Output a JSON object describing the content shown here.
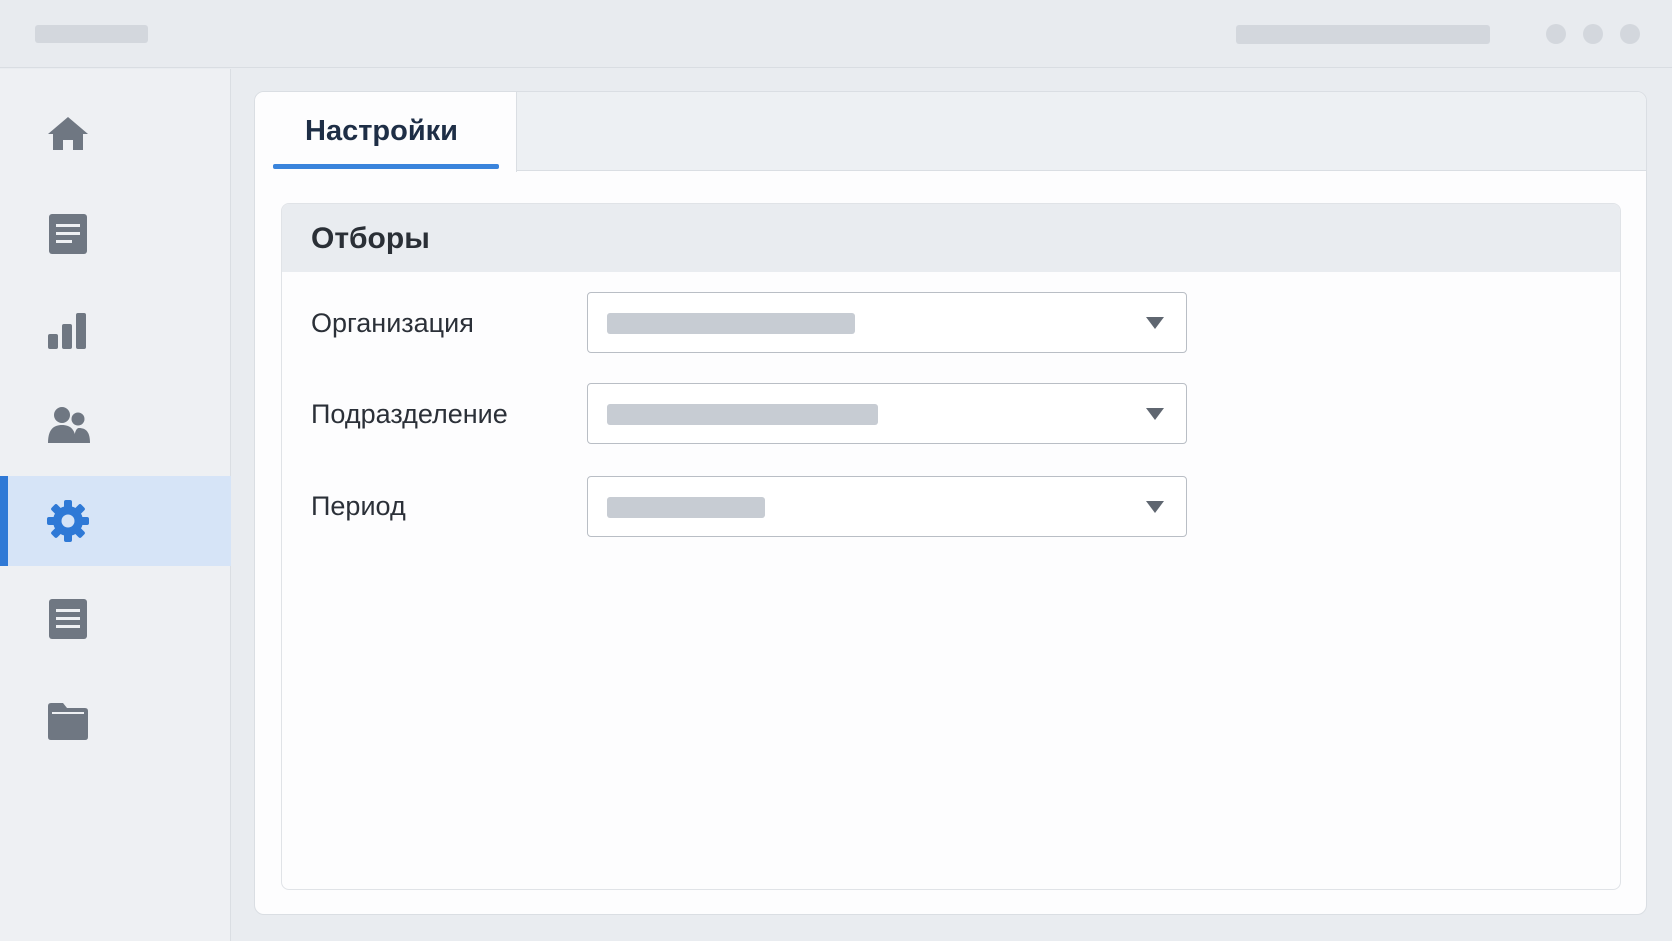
{
  "main": {
    "tabs": [
      {
        "label": "Настройки",
        "active": true
      }
    ],
    "filters": {
      "title": "Отборы",
      "fields": [
        {
          "label": "Организация",
          "value": ""
        },
        {
          "label": "Подразделение",
          "value": ""
        },
        {
          "label": "Период",
          "value": ""
        }
      ]
    }
  },
  "sidebar": {
    "items": [
      {
        "icon": "home-icon"
      },
      {
        "icon": "document-icon"
      },
      {
        "icon": "bar-chart-icon"
      },
      {
        "icon": "users-icon"
      },
      {
        "icon": "gear-icon",
        "active": true
      },
      {
        "icon": "list-icon"
      },
      {
        "icon": "folder-icon"
      }
    ]
  },
  "colors": {
    "accent": "#2f79d6",
    "icon": "#6f7782",
    "active_bg": "#d6e4f7"
  }
}
